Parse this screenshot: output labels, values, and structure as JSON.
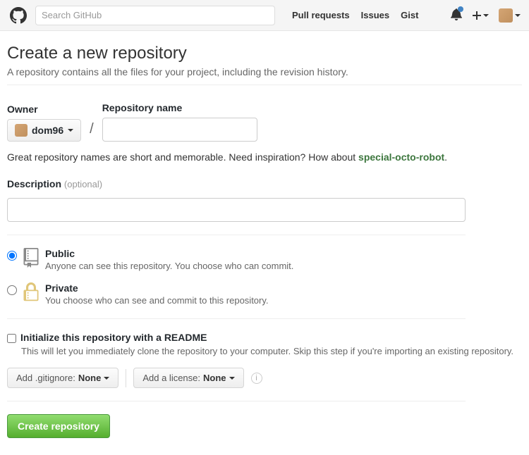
{
  "header": {
    "search_placeholder": "Search GitHub",
    "nav": {
      "pull_requests": "Pull requests",
      "issues": "Issues",
      "gist": "Gist"
    }
  },
  "page": {
    "title": "Create a new repository",
    "subtitle": "A repository contains all the files for your project, including the revision history."
  },
  "form": {
    "owner_label": "Owner",
    "owner_value": "dom96",
    "repo_name_label": "Repository name",
    "repo_name_value": "",
    "hint_prefix": "Great repository names are short and memorable. Need inspiration? How about ",
    "suggestion": "special-octo-robot",
    "hint_suffix": ".",
    "description_label": "Description",
    "optional_text": "(optional)",
    "description_value": "",
    "visibility": {
      "public_label": "Public",
      "public_desc": "Anyone can see this repository. You choose who can commit.",
      "private_label": "Private",
      "private_desc": "You choose who can see and commit to this repository."
    },
    "readme": {
      "label": "Initialize this repository with a README",
      "desc": "This will let you immediately clone the repository to your computer. Skip this step if you're importing an existing repository."
    },
    "gitignore": {
      "prefix": "Add .gitignore: ",
      "value": "None"
    },
    "license": {
      "prefix": "Add a license: ",
      "value": "None"
    },
    "submit": "Create repository"
  }
}
